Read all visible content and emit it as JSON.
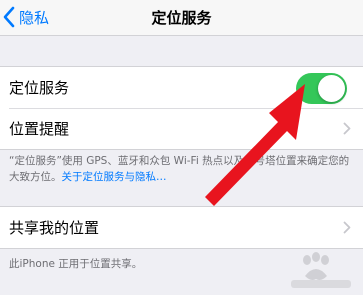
{
  "navbar": {
    "back_label": "隐私",
    "title": "定位服务"
  },
  "settings": {
    "location_services_label": "定位服务",
    "location_services_enabled": true,
    "location_alerts_label": "位置提醒",
    "description_text": "“定位服务”使用 GPS、蓝牙和众包 Wi-Fi 热点以及信号塔位置来确定您的大致方位。",
    "about_link": "关于定位服务与隐私…",
    "share_location_label": "共享我的位置",
    "share_note": "此iPhone 正用于位置共享。"
  },
  "colors": {
    "accent": "#007aff",
    "toggle_on": "#34c759",
    "annotation_arrow": "#e8141e",
    "background": "#efeff4"
  },
  "icons": {
    "back": "chevron-left-icon",
    "disclosure": "chevron-right-icon",
    "annotation": "red-arrow-annotation"
  },
  "watermark": {
    "text": "Baidu经验"
  }
}
